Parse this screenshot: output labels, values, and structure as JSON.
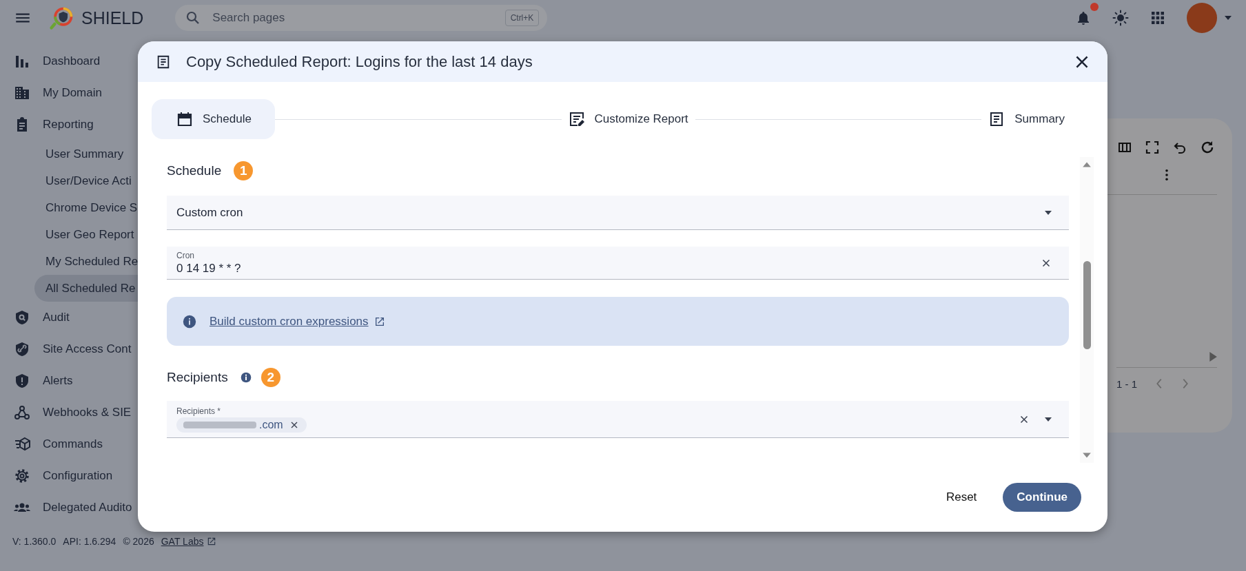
{
  "header": {
    "brand": "SHIELD",
    "search": {
      "placeholder": "Search pages",
      "shortcut": "Ctrl+K"
    },
    "notifications": {
      "unread": true
    }
  },
  "sidebar": {
    "items": [
      {
        "label": "Dashboard",
        "selected": false
      },
      {
        "label": "My Domain",
        "selected": false
      },
      {
        "label": "Reporting",
        "selected": false,
        "children": [
          {
            "label": "User Summary",
            "selected": false
          },
          {
            "label": "User/Device Acti",
            "selected": false
          },
          {
            "label": "Chrome Device S",
            "selected": false
          },
          {
            "label": "User Geo Report",
            "selected": false
          },
          {
            "label": "My Scheduled Re",
            "selected": false
          },
          {
            "label": "All Scheduled Re",
            "selected": true
          }
        ]
      },
      {
        "label": "Audit",
        "selected": false
      },
      {
        "label": "Site Access Cont",
        "selected": false
      },
      {
        "label": "Alerts",
        "selected": false
      },
      {
        "label": "Webhooks & SIE",
        "selected": false
      },
      {
        "label": "Commands",
        "selected": false
      },
      {
        "label": "Configuration",
        "selected": false
      },
      {
        "label": "Delegated Audito",
        "selected": false
      }
    ]
  },
  "footer": {
    "version": "V: 1.360.0",
    "api": "API: 1.6.294",
    "copyright": "© 2026",
    "link": "GAT Labs"
  },
  "background_table": {
    "pagination": "1 - 1"
  },
  "dialog": {
    "title": "Copy Scheduled Report: Logins for the last 14 days",
    "steps": [
      {
        "label": "Schedule",
        "selected": true
      },
      {
        "label": "Customize Report",
        "selected": false
      },
      {
        "label": "Summary",
        "selected": false
      }
    ],
    "schedule": {
      "heading": "Schedule",
      "number": "1",
      "frequency": "Custom cron",
      "cron": {
        "label": "Cron",
        "value": "0 14 19 * * ?"
      },
      "help_link": "Build custom cron expressions"
    },
    "recipients": {
      "heading": "Recipients",
      "number": "2",
      "label": "Recipients *",
      "chips": [
        {
          "text": ".com",
          "redacted": true
        }
      ]
    },
    "buttons": [
      {
        "label": "Reset",
        "kind": "text"
      },
      {
        "label": "Continue",
        "kind": "primary"
      }
    ]
  }
}
